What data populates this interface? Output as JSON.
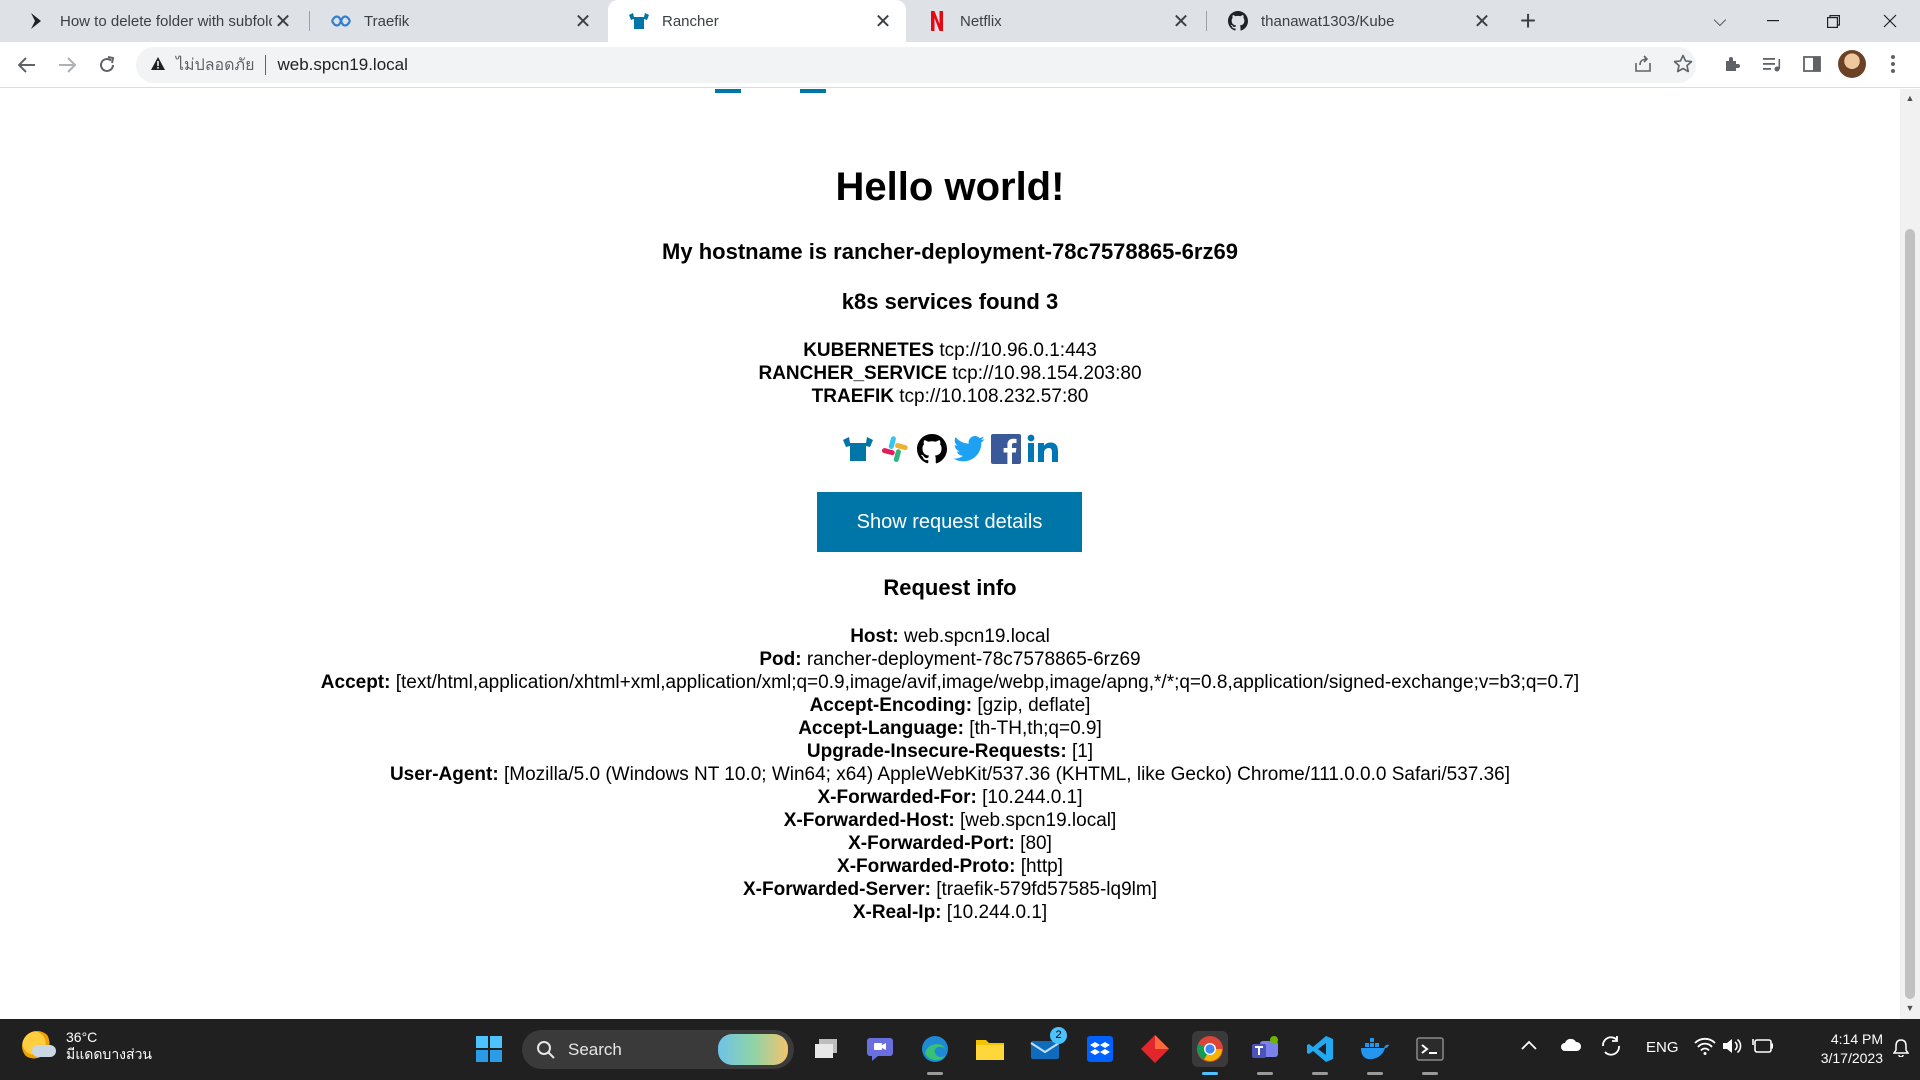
{
  "browser": {
    "tabs": [
      {
        "title": "How to delete folder with subfold",
        "favicon": "chevron-favicon",
        "active": false
      },
      {
        "title": "Traefik",
        "favicon": "traefik-favicon",
        "active": false
      },
      {
        "title": "Rancher",
        "favicon": "rancher-favicon",
        "active": true
      },
      {
        "title": "Netflix",
        "favicon": "netflix-favicon",
        "active": false
      },
      {
        "title": "thanawat1303/Kube",
        "favicon": "github-favicon",
        "active": false
      }
    ],
    "new_tab": "+",
    "address": {
      "security_label": "ไม่ปลอดภัย",
      "url": "web.spcn19.local"
    }
  },
  "page": {
    "heading": "Hello world!",
    "hostname_line": "My hostname is rancher-deployment-78c7578865-6rz69",
    "services_line": "k8s services found 3",
    "services": [
      {
        "name": "KUBERNETES",
        "value": "tcp://10.96.0.1:443"
      },
      {
        "name": "RANCHER_SERVICE",
        "value": "tcp://10.98.154.203:80"
      },
      {
        "name": "TRAEFIK",
        "value": "tcp://10.108.232.57:80"
      }
    ],
    "social_icons": [
      "rancher-icon",
      "slack-icon",
      "github-icon",
      "twitter-icon",
      "facebook-icon",
      "linkedin-icon"
    ],
    "request_button": "Show request details",
    "request_info_title": "Request info",
    "request_info": [
      {
        "key": "Host:",
        "value": "web.spcn19.local"
      },
      {
        "key": "Pod:",
        "value": "rancher-deployment-78c7578865-6rz69"
      },
      {
        "key": "Accept:",
        "value": "[text/html,application/xhtml+xml,application/xml;q=0.9,image/avif,image/webp,image/apng,*/*;q=0.8,application/signed-exchange;v=b3;q=0.7]"
      },
      {
        "key": "Accept-Encoding:",
        "value": "[gzip, deflate]"
      },
      {
        "key": "Accept-Language:",
        "value": "[th-TH,th;q=0.9]"
      },
      {
        "key": "Upgrade-Insecure-Requests:",
        "value": "[1]"
      },
      {
        "key": "User-Agent:",
        "value": "[Mozilla/5.0 (Windows NT 10.0; Win64; x64) AppleWebKit/537.36 (KHTML, like Gecko) Chrome/111.0.0.0 Safari/537.36]"
      },
      {
        "key": "X-Forwarded-For:",
        "value": "[10.244.0.1]"
      },
      {
        "key": "X-Forwarded-Host:",
        "value": "[web.spcn19.local]"
      },
      {
        "key": "X-Forwarded-Port:",
        "value": "[80]"
      },
      {
        "key": "X-Forwarded-Proto:",
        "value": "[http]"
      },
      {
        "key": "X-Forwarded-Server:",
        "value": "[traefik-579fd57585-lq9lm]"
      },
      {
        "key": "X-Real-Ip:",
        "value": "[10.244.0.1]"
      }
    ]
  },
  "taskbar": {
    "weather_temp": "36°C",
    "weather_desc": "มีแดดบางส่วน",
    "search_label": "Search",
    "mail_badge": "2",
    "language": "ENG",
    "time": "4:14 PM",
    "date": "3/17/2023"
  },
  "colors": {
    "accent": "#0075a8",
    "tab_strip": "#dee1e6",
    "taskbar": "#202020"
  }
}
